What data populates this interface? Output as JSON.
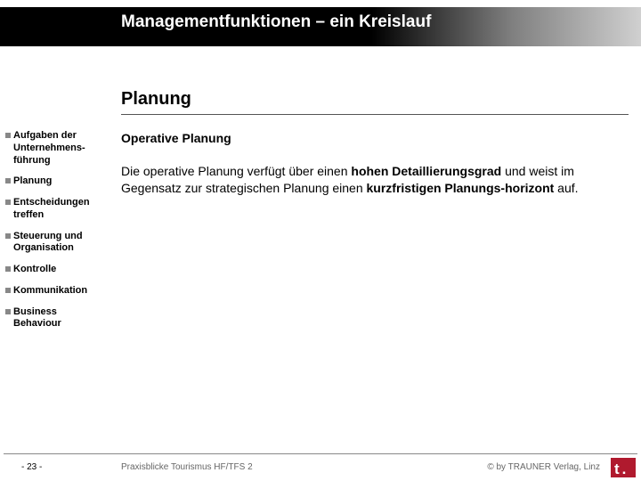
{
  "header": {
    "title": "Managementfunktionen – ein Kreislauf"
  },
  "chapter": "Planung",
  "sidebar": {
    "items": [
      {
        "label": "Aufgaben der Unternehmens-führung"
      },
      {
        "label": "Planung"
      },
      {
        "label": "Entscheidungen treffen"
      },
      {
        "label": "Steuerung und Organisation"
      },
      {
        "label": "Kontrolle"
      },
      {
        "label": "Kommunikation"
      },
      {
        "label": "Business Behaviour"
      }
    ]
  },
  "content": {
    "subtitle": "Operative Planung",
    "body_pre": "Die operative Planung verfügt über einen ",
    "body_b1": "hohen Detaillierungsgrad",
    "body_mid": " und weist im Gegensatz zur strategischen Planung einen ",
    "body_b2": "kurzfristigen Planungs-horizont",
    "body_post": " auf."
  },
  "footer": {
    "page": "- 23 -",
    "left": "Praxisblicke Tourismus HF/TFS 2",
    "right": "© by TRAUNER Verlag, Linz",
    "logo_text": "t",
    "logo_dot": "."
  }
}
